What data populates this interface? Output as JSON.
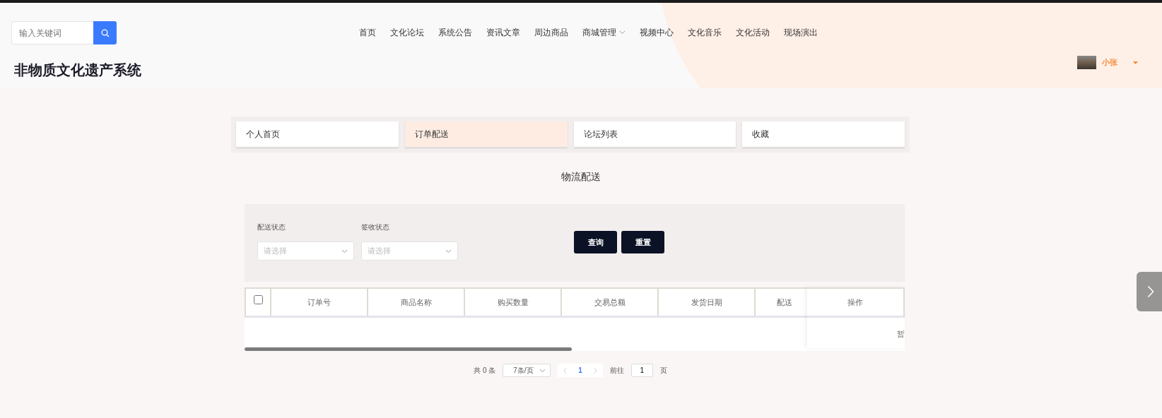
{
  "header": {
    "search": {
      "placeholder": "输入关键词"
    },
    "site_title": "非物质文化遗产系统",
    "user": {
      "name": "小张"
    }
  },
  "nav": [
    {
      "label": "首页",
      "kind": "link"
    },
    {
      "label": "文化论坛",
      "kind": "link"
    },
    {
      "label": "系统公告",
      "kind": "link"
    },
    {
      "label": "资讯文章",
      "kind": "link"
    },
    {
      "label": "周边商品",
      "kind": "link"
    },
    {
      "label": "商城管理",
      "kind": "dropdown"
    },
    {
      "label": "视频中心",
      "kind": "link"
    },
    {
      "label": "文化音乐",
      "kind": "link"
    },
    {
      "label": "文化活动",
      "kind": "link"
    },
    {
      "label": "现场演出",
      "kind": "link"
    }
  ],
  "tabs": [
    {
      "label": "个人首页",
      "selected": false
    },
    {
      "label": "订单配送",
      "selected": true
    },
    {
      "label": "论坛列表",
      "selected": false
    },
    {
      "label": "收藏",
      "selected": false
    }
  ],
  "section_title": "物流配送",
  "filters": [
    {
      "label": "配送状态",
      "placeholder": "请选择"
    },
    {
      "label": "签收状态",
      "placeholder": "请选择"
    }
  ],
  "buttons": [
    "查询",
    "重置"
  ],
  "table": {
    "select_all": {
      "checked": false
    },
    "columns": [
      "订单号",
      "商品名称",
      "购买数量",
      "交易总额",
      "发货日期",
      "配送"
    ],
    "fixed_column": "操作",
    "empty_text": "暂"
  },
  "pagination": {
    "total": "共 0 条",
    "page_size": "7条/页",
    "pages": [
      {
        "label": "1",
        "selected": true
      }
    ],
    "goto_label": "前往",
    "goto_value": "1",
    "goto_suffix": "页"
  }
}
